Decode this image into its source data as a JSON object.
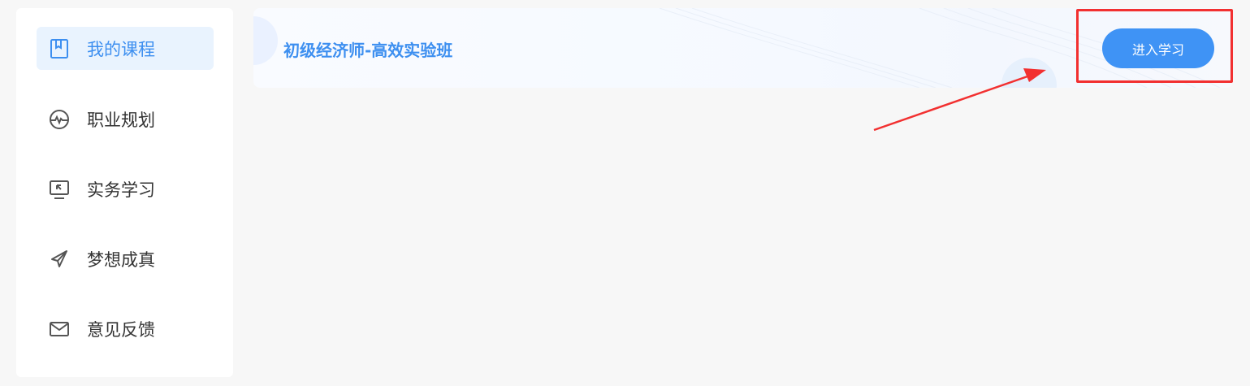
{
  "sidebar": {
    "items": [
      {
        "label": "我的课程",
        "icon": "book-icon",
        "active": true
      },
      {
        "label": "职业规划",
        "icon": "pulse-icon",
        "active": false
      },
      {
        "label": "实务学习",
        "icon": "monitor-icon",
        "active": false
      },
      {
        "label": "梦想成真",
        "icon": "paper-plane-icon",
        "active": false
      },
      {
        "label": "意见反馈",
        "icon": "mail-icon",
        "active": false
      }
    ]
  },
  "course": {
    "title": "初级经济师-高效实验班",
    "enter_label": "进入学习"
  },
  "colors": {
    "accent": "#3f93f5",
    "active_bg": "#e9f3fe",
    "annotation": "#f23030",
    "page_bg": "#f7f7f7"
  }
}
